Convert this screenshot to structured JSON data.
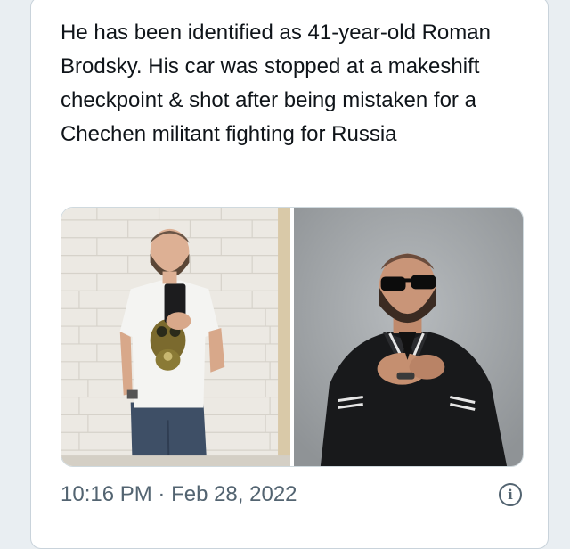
{
  "tweet": {
    "text": "He has been identified as 41-year-old Roman Brodsky. His car was stopped at a makeshift checkpoint & shot after being mistaken for a Chechen militant fighting for Russia",
    "time": "10:16 PM",
    "separator": " · ",
    "date": "Feb 28, 2022"
  },
  "media": {
    "photos": [
      {
        "description_icon": "photo-man-mirror-selfie"
      },
      {
        "description_icon": "photo-man-sunglasses-jacket"
      }
    ]
  },
  "icons": {
    "info": "info-icon",
    "info_glyph": "i"
  },
  "colors": {
    "text_primary": "#0f1419",
    "text_secondary": "#536471",
    "page_background": "#e9eef2",
    "card_border": "#c9d3db"
  }
}
